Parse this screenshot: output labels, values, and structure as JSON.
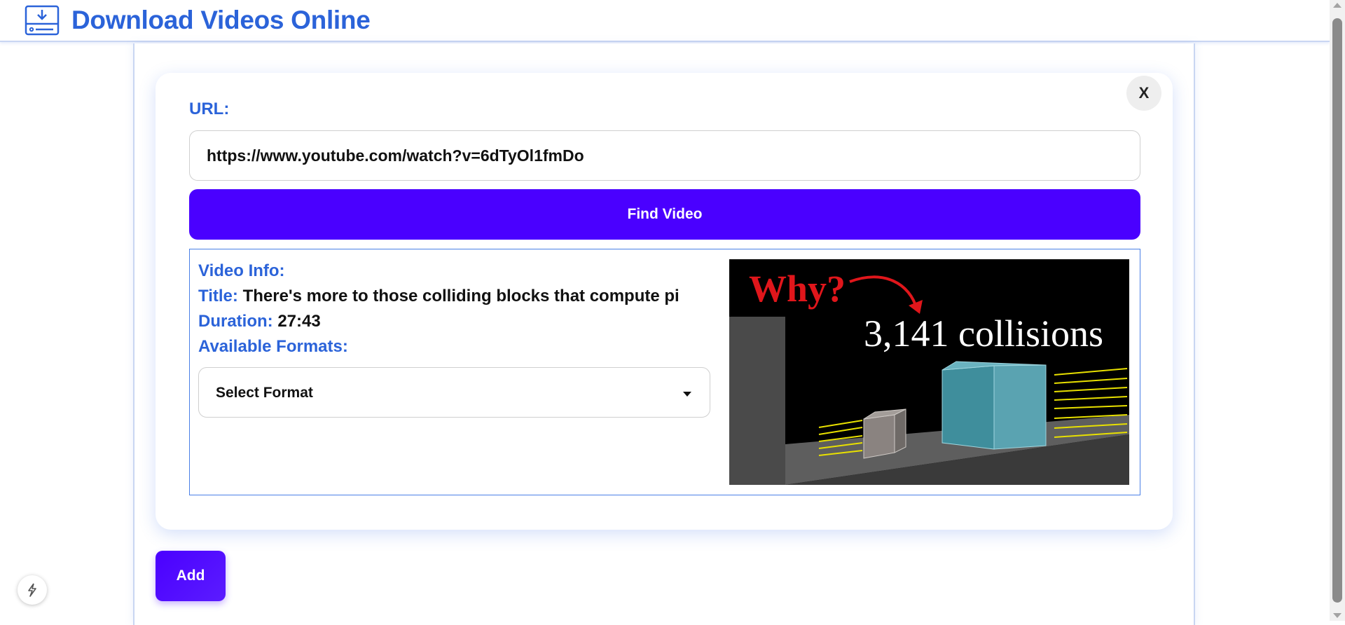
{
  "header": {
    "title": "Download Videos Online",
    "logo_icon": "download-tray-icon"
  },
  "form": {
    "url_label": "URL:",
    "url_value": "https://www.youtube.com/watch?v=6dTyOl1fmDo",
    "find_button": "Find Video",
    "close_button": "X"
  },
  "video_info": {
    "heading": "Video Info:",
    "title_key": "Title:",
    "title_value": "There's more to those colliding blocks that compute pi",
    "duration_key": "Duration:",
    "duration_value": "27:43",
    "formats_key": "Available Formats:",
    "format_selected": "Select Format",
    "thumbnail": {
      "why_text": "Why?",
      "collisions_text": "3,141 collisions"
    }
  },
  "actions": {
    "add_button": "Add"
  },
  "colors": {
    "accent": "#2b63d9",
    "button": "#4a00ff",
    "thumb_bg": "#000000",
    "why_red": "#e0161b"
  }
}
